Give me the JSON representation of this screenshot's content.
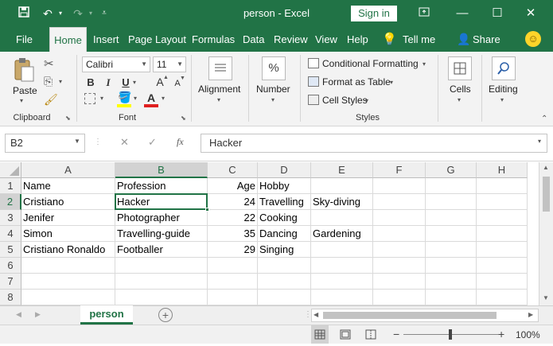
{
  "titlebar": {
    "title": "person  -  Excel",
    "signin": "Sign in",
    "save_icon": "save-icon",
    "undo_icon": "undo-icon",
    "redo_icon": "redo-icon",
    "minimize": "—",
    "restore": "☐",
    "close": "✕"
  },
  "tabs": [
    "File",
    "Home",
    "Insert",
    "Page Layout",
    "Formulas",
    "Data",
    "Review",
    "View",
    "Help"
  ],
  "tellme": "Tell me",
  "share": "Share",
  "ribbon": {
    "paste": "Paste",
    "clipboard": "Clipboard",
    "font_name": "Calibri",
    "font_size": "11",
    "font_group": "Font",
    "alignment": "Alignment",
    "number": "Number",
    "number_symbol": "%",
    "conditional": "Conditional Formatting",
    "format_table": "Format as Table",
    "cell_styles": "Cell Styles",
    "styles": "Styles",
    "cells": "Cells",
    "editing": "Editing",
    "bold": "B",
    "italic": "I",
    "underline": "U",
    "grow": "A",
    "shrink": "A",
    "font_color_glyph": "A"
  },
  "formula_bar": {
    "namebox": "B2",
    "cancel": "✕",
    "enter": "✓",
    "fx": "fx",
    "content": "Hacker"
  },
  "grid": {
    "columns": [
      "A",
      "B",
      "C",
      "D",
      "E",
      "F",
      "G",
      "H"
    ],
    "rows": [
      "1",
      "2",
      "3",
      "4",
      "5",
      "6",
      "7",
      "8"
    ],
    "cells": [
      [
        "Name",
        "Profession",
        "Age",
        "Hobby",
        "",
        "",
        "",
        ""
      ],
      [
        "Cristiano",
        "Hacker",
        "24",
        "Travelling",
        "Sky-diving",
        "",
        "",
        ""
      ],
      [
        "Jenifer",
        "Photographer",
        "22",
        "Cooking",
        "",
        "",
        "",
        ""
      ],
      [
        "Simon",
        "Travelling-guide",
        "35",
        "Dancing",
        "Gardening",
        "",
        "",
        ""
      ],
      [
        "Cristiano Ronaldo",
        "Footballer",
        "29",
        "Singing",
        "",
        "",
        "",
        ""
      ],
      [
        "",
        "",
        "",
        "",
        "",
        "",
        "",
        ""
      ],
      [
        "",
        "",
        "",
        "",
        "",
        "",
        "",
        ""
      ],
      [
        "",
        "",
        "",
        "",
        "",
        "",
        "",
        ""
      ]
    ],
    "numeric_columns": [
      2
    ],
    "active_cell": "B2"
  },
  "sheet_tab": "person",
  "add_sheet": "+",
  "zoom": "100%",
  "zoom_minus": "−",
  "zoom_plus": "+",
  "colors": {
    "accent": "#217346",
    "ribbon": "#f3f3f3",
    "header": "#efefef"
  }
}
